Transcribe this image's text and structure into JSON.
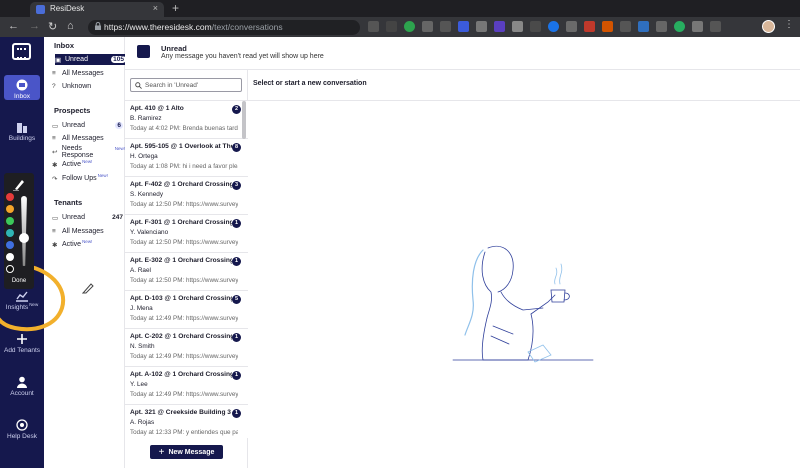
{
  "browser": {
    "tab_title": "ResiDesk",
    "url_host": "https://www.theresidesk.com",
    "url_path": "/text/conversations"
  },
  "rail": {
    "items": [
      {
        "label": "Inbox",
        "icon": "inbox-icon"
      },
      {
        "label": "Buildings",
        "icon": "buildings-icon"
      },
      {
        "label": "Insights",
        "sup": "New",
        "icon": "chart-icon"
      },
      {
        "label": "Add Tenants",
        "icon": "plus-icon"
      },
      {
        "label": "Account",
        "icon": "account-icon"
      },
      {
        "label": "Help Desk",
        "icon": "help-icon"
      }
    ]
  },
  "nav": {
    "inbox": {
      "heading": "Inbox",
      "items": [
        {
          "label": "Unread",
          "count": "105"
        },
        {
          "label": "All Messages"
        },
        {
          "label": "Unknown"
        }
      ]
    },
    "prospects": {
      "heading": "Prospects",
      "items": [
        {
          "label": "Unread",
          "count": "6"
        },
        {
          "label": "All Messages"
        },
        {
          "label": "Needs Response",
          "sup": "New!"
        },
        {
          "label": "Active",
          "sup": "New!"
        },
        {
          "label": "Follow Ups",
          "sup": "New!"
        }
      ]
    },
    "tenants": {
      "heading": "Tenants",
      "items": [
        {
          "label": "Unread",
          "count": "247"
        },
        {
          "label": "All Messages"
        },
        {
          "label": "Active",
          "sup": "New!"
        }
      ]
    }
  },
  "header": {
    "title": "Unread",
    "subtitle": "Any message you haven't read yet will show up here"
  },
  "search": {
    "placeholder": "Search in 'Unread'"
  },
  "conversations": [
    {
      "title": "Apt. 410 @ 1 Alto",
      "name": "B. Ramirez",
      "preview": "Today at 4:02 PM: Brenda buenas tardes",
      "badge": "2"
    },
    {
      "title": "Apt. 595-105 @ 1 Overlook at Thornton",
      "name": "H. Ortega",
      "preview": "Today at 1:08 PM: hi i need a favor please",
      "badge": "8"
    },
    {
      "title": "Apt. F-402 @ 1 Orchard Crossing",
      "name": "S. Kennedy",
      "preview": "Today at 12:50 PM: https://www.survey",
      "badge": "3"
    },
    {
      "title": "Apt. F-301 @ 1 Orchard Crossing",
      "name": "Y. Valenciano",
      "preview": "Today at 12:50 PM: https://www.survey",
      "badge": "1"
    },
    {
      "title": "Apt. E-302 @ 1 Orchard Crossing",
      "name": "A. Rael",
      "preview": "Today at 12:50 PM: https://www.survey",
      "badge": "1"
    },
    {
      "title": "Apt. D-103 @ 1 Orchard Crossing",
      "name": "J. Mena",
      "preview": "Today at 12:49 PM: https://www.survey",
      "badge": "5"
    },
    {
      "title": "Apt. C-202 @ 1 Orchard Crossing",
      "name": "N. Smith",
      "preview": "Today at 12:49 PM: https://www.survey",
      "badge": "1"
    },
    {
      "title": "Apt. A-102 @ 1 Orchard Crossing",
      "name": "Y. Lee",
      "preview": "Today at 12:49 PM: https://www.survey",
      "badge": "1"
    },
    {
      "title": "Apt. 321 @ Creekside Building 3",
      "name": "A. Rojas",
      "preview": "Today at 12:33 PM: y entiendes que pasa",
      "badge": "1"
    }
  ],
  "new_message_label": "New Message",
  "main": {
    "prompt": "Select or start a new conversation"
  },
  "annotation_toolbar": {
    "done_label": "Done",
    "colors": [
      "#e63b3b",
      "#f4a52a",
      "#3cc95a",
      "#2fb5b5",
      "#3f6fe0",
      "#ffffff",
      "#111111"
    ]
  },
  "colors": {
    "navy": "#15184d",
    "accent": "#4a55c8",
    "highlight": "#f2b02c"
  }
}
